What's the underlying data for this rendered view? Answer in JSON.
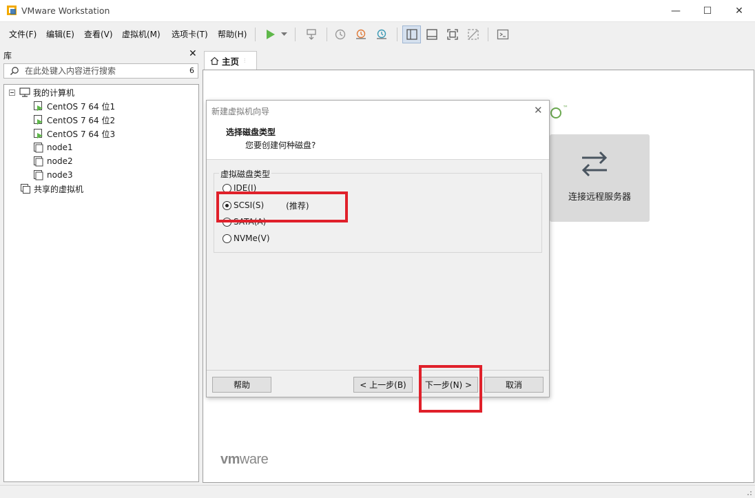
{
  "window": {
    "title": "VMware Workstation",
    "min_glyph": "—",
    "max_glyph": "☐",
    "close_glyph": "✕"
  },
  "menu": [
    {
      "label": "文件(F)"
    },
    {
      "label": "编辑(E)"
    },
    {
      "label": "查看(V)"
    },
    {
      "label": "虚拟机(M)"
    },
    {
      "label": "选项卡(T)"
    },
    {
      "label": "帮助(H)"
    }
  ],
  "toolbar": {
    "icons": [
      "play-icon",
      "dropdown-icon",
      "send-keys-icon",
      "snapshot-icon",
      "revert-snapshot-icon",
      "snapshot-manager-icon",
      "library-view-icon",
      "thumbnail-bar-icon",
      "fullscreen-icon",
      "unity-icon",
      "console-icon"
    ]
  },
  "library": {
    "title": "库",
    "close_glyph": "✕",
    "search_placeholder": "在此处键入内容进行搜索",
    "search_count": "6",
    "tree": [
      {
        "label": "我的计算机",
        "type": "computer"
      },
      {
        "label": "CentOS 7 64 位1",
        "type": "vm-running"
      },
      {
        "label": "CentOS 7 64 位2",
        "type": "vm-running"
      },
      {
        "label": "CentOS 7 64 位3",
        "type": "vm-running"
      },
      {
        "label": "node1",
        "type": "vm"
      },
      {
        "label": "node2",
        "type": "vm"
      },
      {
        "label": "node3",
        "type": "vm"
      },
      {
        "label": "共享的虚拟机",
        "type": "shared"
      }
    ]
  },
  "tabs": [
    {
      "label": "主页"
    }
  ],
  "home": {
    "remote_label": "连接远程服务器",
    "brand": {
      "bold": "vm",
      "rest": "ware"
    }
  },
  "dialog": {
    "title": "新建虚拟机向导",
    "close_glyph": "✕",
    "heading": "选择磁盘类型",
    "subheading": "您要创建何种磁盘?",
    "group_label": "虚拟磁盘类型",
    "options": [
      {
        "label": "IDE(I)",
        "checked": false
      },
      {
        "label": "SCSI(S)",
        "checked": true,
        "note": "(推荐)"
      },
      {
        "label": "SATA(A)",
        "checked": false
      },
      {
        "label": "NVMe(V)",
        "checked": false
      }
    ],
    "buttons": {
      "help": "帮助",
      "back": "< 上一步(B)",
      "next": "下一步(N) >",
      "cancel": "取消"
    }
  },
  "colors": {
    "highlight": "#e0202a",
    "play_green": "#5fb84a",
    "accent_blue": "#2b6cb0"
  }
}
